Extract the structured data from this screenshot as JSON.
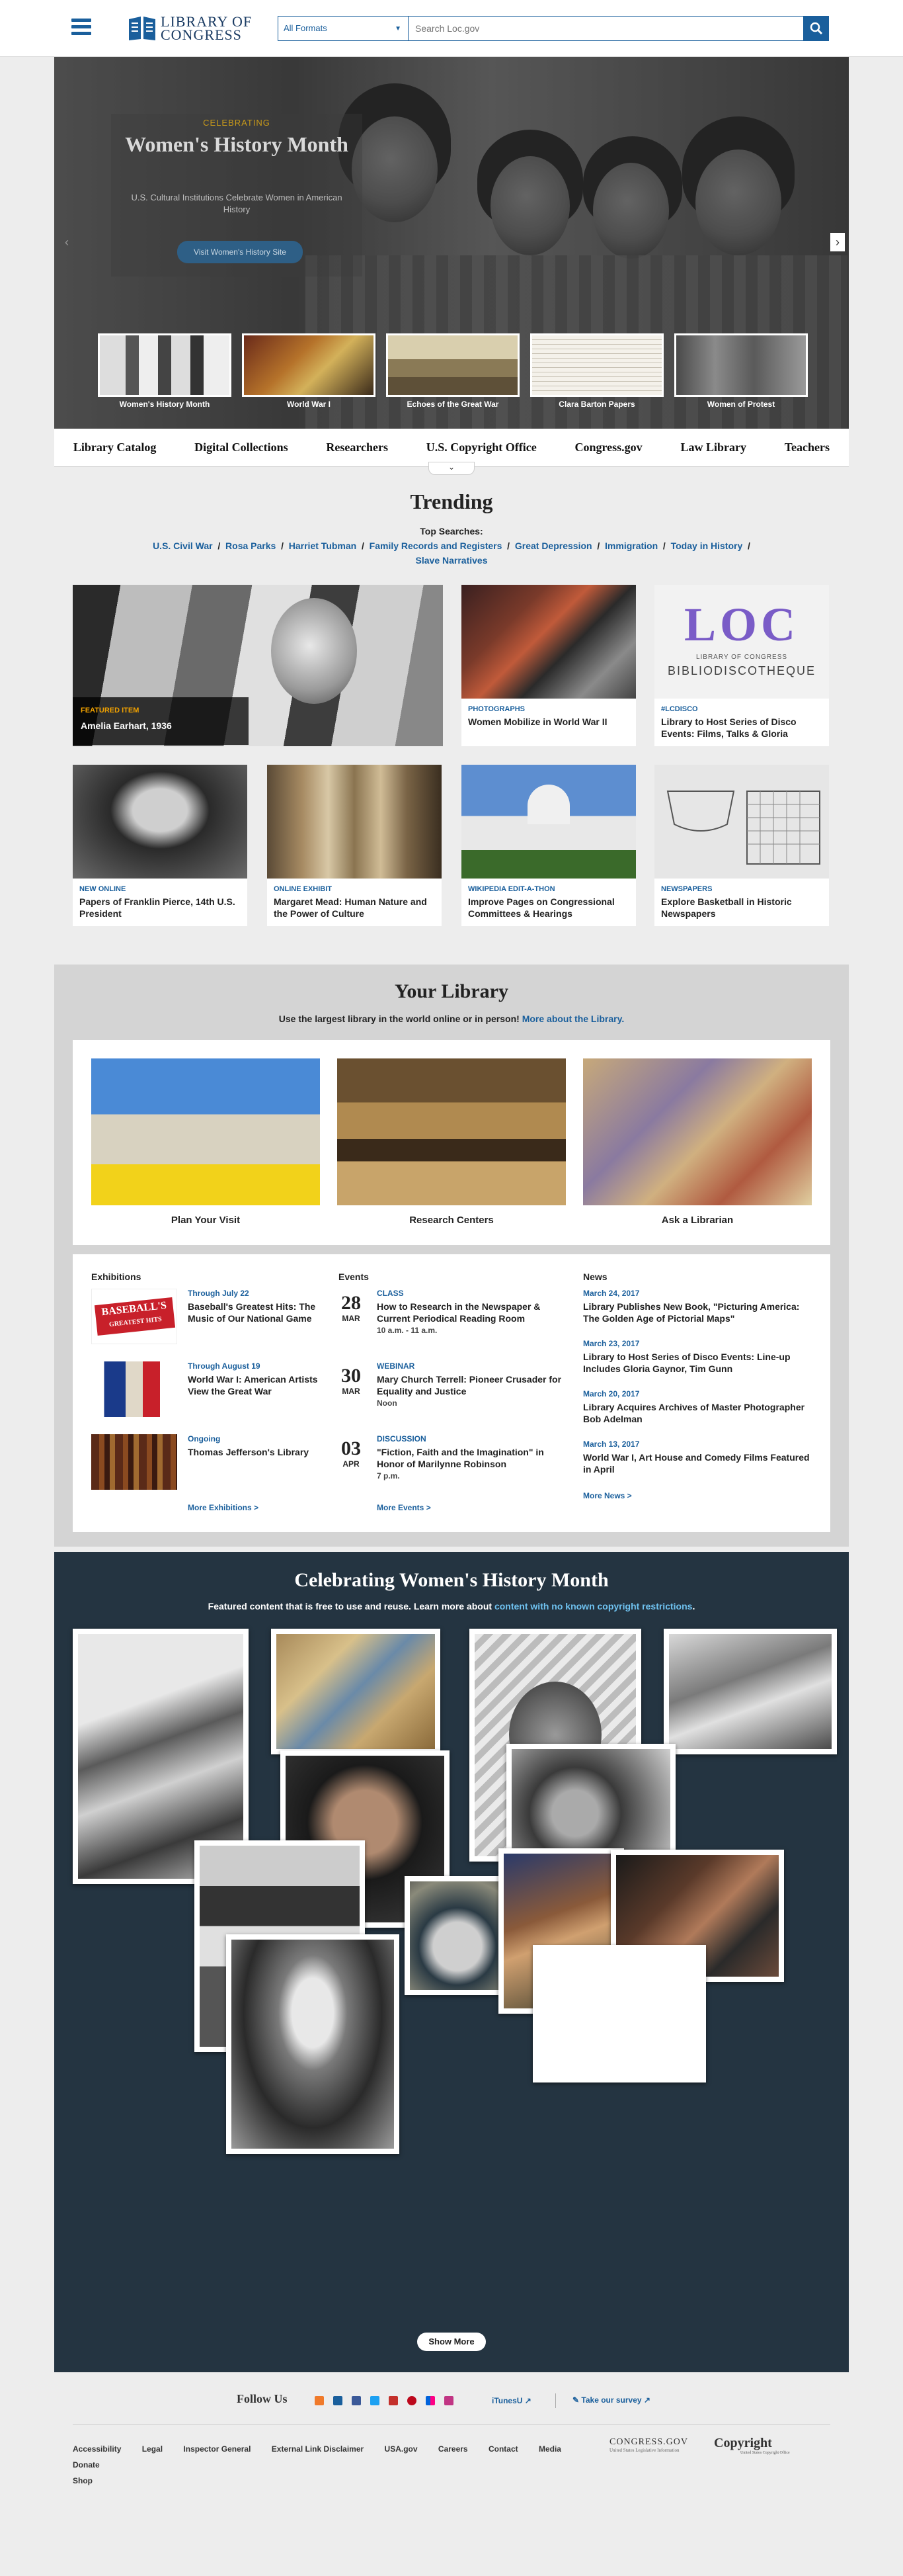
{
  "header": {
    "logo_line1": "LIBRARY OF",
    "logo_line2": "CONGRESS",
    "format_select": "All Formats",
    "search_placeholder": "Search Loc.gov"
  },
  "hero": {
    "kicker": "CELEBRATING",
    "title": "Women's History Month",
    "description": "U.S. Cultural Institutions Celebrate Women in American History",
    "cta": "Visit Women's History Site",
    "thumbnails": [
      {
        "label": "Women's History Month"
      },
      {
        "label": "World War I"
      },
      {
        "label": "Echoes of the Great War"
      },
      {
        "label": "Clara Barton Papers"
      },
      {
        "label": "Women of Protest"
      }
    ]
  },
  "quicknav": [
    "Library Catalog",
    "Digital Collections",
    "Researchers",
    "U.S. Copyright Office",
    "Congress.gov",
    "Law Library",
    "Teachers"
  ],
  "trending": {
    "title": "Trending",
    "top_searches_label": "Top Searches:",
    "top_searches": [
      "U.S. Civil War",
      "Rosa Parks",
      "Harriet Tubman",
      "Family Records and Registers",
      "Great Depression",
      "Immigration",
      "Today in History",
      "Slave Narratives"
    ],
    "featured": {
      "kind": "FEATURED ITEM",
      "title": "Amelia Earhart, 1936"
    },
    "cards": [
      {
        "kind": "PHOTOGRAPHS",
        "title": "Women Mobilize in World War II"
      },
      {
        "kind": "#LCDISCO",
        "title": "Library to Host Series of Disco Events: Films, Talks & Gloria"
      },
      {
        "kind": "NEW ONLINE",
        "title": "Papers of Franklin Pierce, 14th U.S. President"
      },
      {
        "kind": "ONLINE EXHIBIT",
        "title": "Margaret Mead: Human Nature and the Power of Culture"
      },
      {
        "kind": "WIKIPEDIA EDIT-A-THON",
        "title": "Improve Pages on Congressional Committees & Hearings"
      },
      {
        "kind": "NEWSPAPERS",
        "title": "Explore Basketball in Historic Newspapers"
      }
    ],
    "disco_art": {
      "letters": "LOC",
      "line1": "LIBRARY OF CONGRESS",
      "line2": "BIBLIODISCOTHEQUE"
    }
  },
  "your_library": {
    "title": "Your Library",
    "subtitle": "Use the largest library in the world online or in person!",
    "subtitle_link": "More about the Library.",
    "items": [
      "Plan Your Visit",
      "Research Centers",
      "Ask a Librarian"
    ]
  },
  "exhibitions": {
    "heading": "Exhibitions",
    "items": [
      {
        "when": "Through July 22",
        "title": "Baseball's Greatest Hits: The Music of Our National Game"
      },
      {
        "when": "Through August 19",
        "title": "World War I: American Artists View the Great War"
      },
      {
        "when": "Ongoing",
        "title": "Thomas Jefferson's Library"
      }
    ],
    "more": "More Exhibitions >",
    "baseball_art": "BASEBALL'S",
    "baseball_art2": "GREATEST HITS"
  },
  "events": {
    "heading": "Events",
    "items": [
      {
        "day": "28",
        "month": "MAR",
        "kind": "CLASS",
        "title": "How to Research in the Newspaper & Current Periodical Reading Room",
        "time": "10 a.m. - 11 a.m."
      },
      {
        "day": "30",
        "month": "MAR",
        "kind": "WEBINAR",
        "title": "Mary Church Terrell: Pioneer Crusader for Equality and Justice",
        "time": "Noon"
      },
      {
        "day": "03",
        "month": "APR",
        "kind": "DISCUSSION",
        "title": "\"Fiction, Faith and the Imagination\" in Honor of Marilynne Robinson",
        "time": "7 p.m."
      }
    ],
    "more": "More Events >"
  },
  "news": {
    "heading": "News",
    "items": [
      {
        "date": "March 24, 2017",
        "title": "Library Publishes New Book, \"Picturing America: The Golden Age of Pictorial Maps\""
      },
      {
        "date": "March 23, 2017",
        "title": "Library to Host Series of Disco Events: Line-up Includes Gloria Gaynor, Tim Gunn"
      },
      {
        "date": "March 20, 2017",
        "title": "Library Acquires Archives of Master Photographer Bob Adelman"
      },
      {
        "date": "March 13, 2017",
        "title": "World War I, Art House and Comedy Films Featured in April"
      }
    ],
    "more": "More News >"
  },
  "womens_history": {
    "title": "Celebrating Women's History Month",
    "subtitle": "Featured content that is free to use and reuse. Learn more about",
    "subtitle_link": "content with no known copyright restrictions",
    "subtitle_end": ".",
    "show_more": "Show More"
  },
  "footer": {
    "follow_label": "Follow Us",
    "itunes": "iTunesU",
    "survey": "Take our survey",
    "links": [
      "Accessibility",
      "Legal",
      "Inspector General",
      "External Link Disclaimer",
      "USA.gov",
      "Careers",
      "Contact",
      "Media",
      "Donate",
      "Shop"
    ],
    "logo1": "CONGRESS.GOV",
    "logo1_sub": "United States Legislative Information",
    "logo2": "Copyright",
    "logo2_sub": "United States Copyright Office"
  }
}
